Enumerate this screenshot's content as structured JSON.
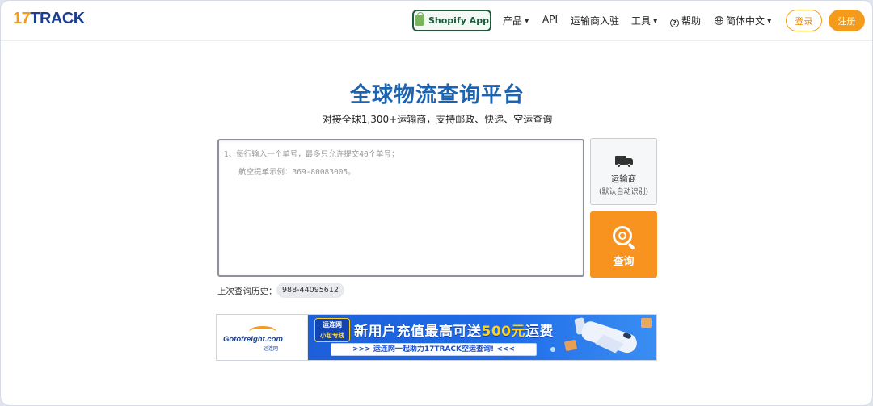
{
  "header": {
    "logo_num": "17",
    "logo_text": "TRACK",
    "shopify_label": "Shopify App",
    "nav": {
      "products": "产品",
      "api": "API",
      "carrier_join": "运输商入驻",
      "tools": "工具",
      "help": "帮助",
      "language": "简体中文"
    },
    "login": "登录",
    "register": "注册"
  },
  "hero": {
    "title": "全球物流查询平台",
    "subtitle": "对接全球1,300+运输商，支持邮政、快递、空运查询"
  },
  "tracking": {
    "value": "",
    "placeholder_line1": "1、每行输入一个单号，最多只允许提交40个单号；",
    "placeholder_line2": "航空提单示例：369-80083005。"
  },
  "carrier_button": {
    "label": "运输商",
    "sub": "(默认自动识别)"
  },
  "search_button": {
    "label": "查询"
  },
  "history": {
    "label": "上次查询历史：",
    "items": [
      "988-44095612"
    ]
  },
  "banner": {
    "logo_text": "Gotofreight.com",
    "logo_sub": "运连网",
    "badge_line1": "运连网",
    "badge_line2": "小包专线",
    "promo_prefix": "新用户充值最高可送",
    "promo_amount": "500元",
    "promo_suffix": "运费",
    "strip_text": ">>> 运连网一起助力17TRACK空运查询! <<<"
  },
  "colors": {
    "brand_blue": "#1d64b0",
    "accent_orange": "#f7931e",
    "shopify_green": "#1d5b3a"
  }
}
